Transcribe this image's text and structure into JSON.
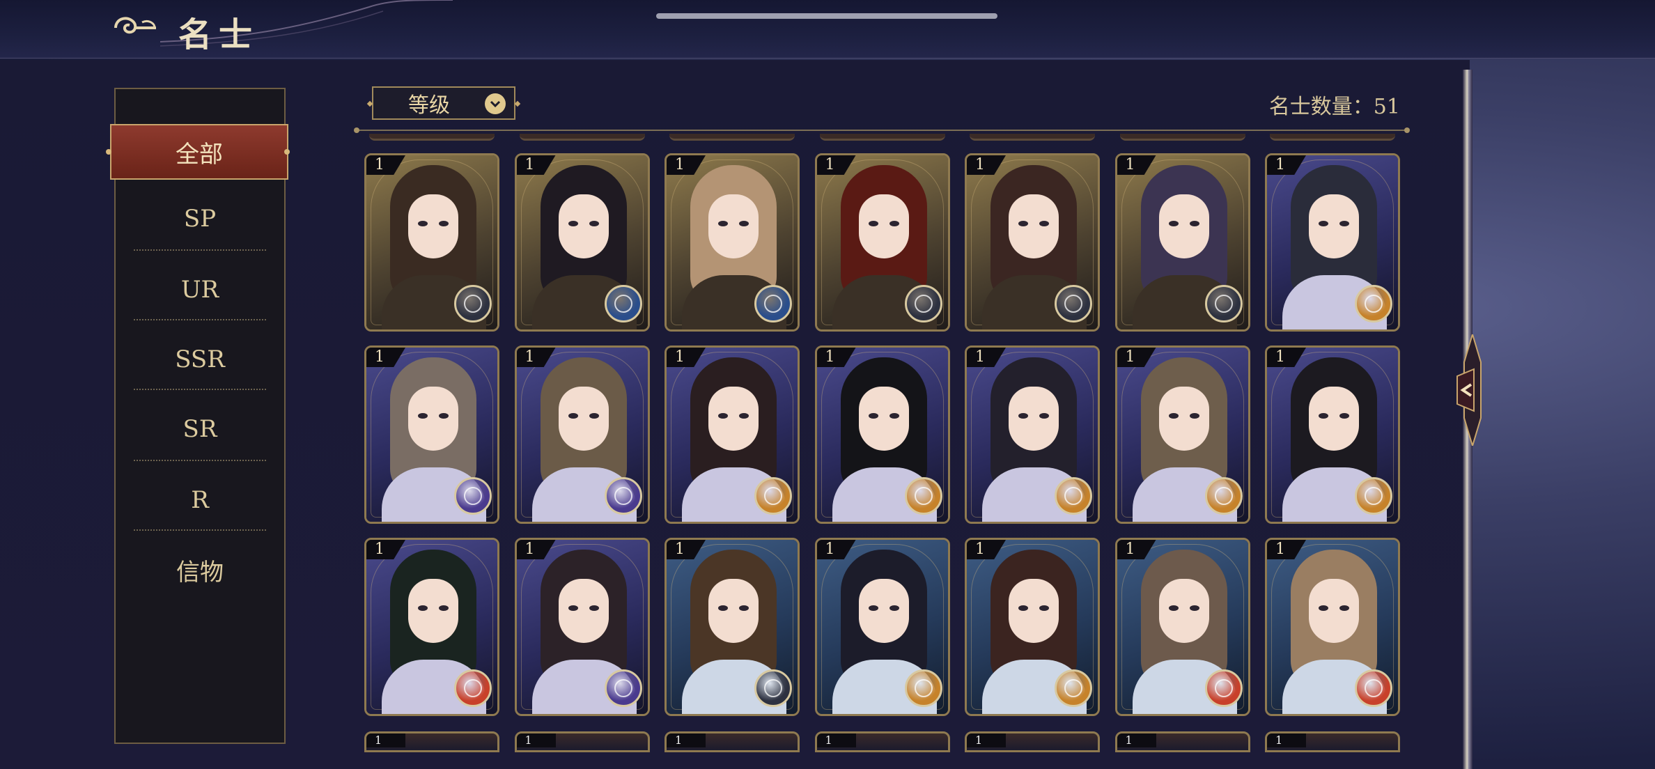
{
  "header": {
    "title": "名士"
  },
  "sidebar": {
    "categories": [
      {
        "label": "全部",
        "active": true
      },
      {
        "label": "SP"
      },
      {
        "label": "UR"
      },
      {
        "label": "SSR"
      },
      {
        "label": "SR"
      },
      {
        "label": "R"
      },
      {
        "label": "信物"
      }
    ]
  },
  "toolbar": {
    "sort_label": "等级",
    "count_label": "名士数量：51"
  },
  "colors": {
    "active_tab": "#7c2d22",
    "gold_border": "#8f7a50",
    "badge_types": {
      "compass": "#2d3140",
      "blue": "#2a4e8c",
      "purple": "#4a3a8e",
      "gold": "#c6822a",
      "red": "#c8402a"
    }
  },
  "cards": [
    {
      "level": "1",
      "bg": "gold",
      "hair": "#3a2b22",
      "badge": "compass"
    },
    {
      "level": "1",
      "bg": "gold",
      "hair": "#1f1a22",
      "badge": "blue"
    },
    {
      "level": "1",
      "bg": "gold",
      "hair": "#b49474",
      "badge": "blue"
    },
    {
      "level": "1",
      "bg": "gold",
      "hair": "#5a1a14",
      "badge": "compass"
    },
    {
      "level": "1",
      "bg": "gold",
      "hair": "#3b2622",
      "badge": "compass"
    },
    {
      "level": "1",
      "bg": "gold",
      "hair": "#3c3452",
      "badge": "compass"
    },
    {
      "level": "1",
      "bg": "purple",
      "hair": "#2a2c3a",
      "badge": "gold"
    },
    {
      "level": "1",
      "bg": "purple",
      "hair": "#7a6d64",
      "badge": "purple"
    },
    {
      "level": "1",
      "bg": "purple",
      "hair": "#6b5b48",
      "badge": "purple"
    },
    {
      "level": "1",
      "bg": "purple",
      "hair": "#2a1e20",
      "badge": "gold"
    },
    {
      "level": "1",
      "bg": "purple",
      "hair": "#141418",
      "badge": "gold"
    },
    {
      "level": "1",
      "bg": "purple",
      "hair": "#23202c",
      "badge": "gold"
    },
    {
      "level": "1",
      "bg": "purple",
      "hair": "#6e5e4c",
      "badge": "gold"
    },
    {
      "level": "1",
      "bg": "purple",
      "hair": "#1c1a20",
      "badge": "gold"
    },
    {
      "level": "1",
      "bg": "purple",
      "hair": "#1a2420",
      "badge": "red"
    },
    {
      "level": "1",
      "bg": "purple",
      "hair": "#2c2228",
      "badge": "purple"
    },
    {
      "level": "1",
      "bg": "blue",
      "hair": "#4b3626",
      "badge": "compass"
    },
    {
      "level": "1",
      "bg": "blue",
      "hair": "#1c1c2a",
      "badge": "gold"
    },
    {
      "level": "1",
      "bg": "blue",
      "hair": "#3b2420",
      "badge": "gold"
    },
    {
      "level": "1",
      "bg": "blue",
      "hair": "#6d5a4c",
      "badge": "red"
    },
    {
      "level": "1",
      "bg": "blue",
      "hair": "#9a7e62",
      "badge": "red"
    }
  ],
  "partial_row_levels": [
    "1",
    "1",
    "1",
    "1",
    "1",
    "1",
    "1"
  ]
}
